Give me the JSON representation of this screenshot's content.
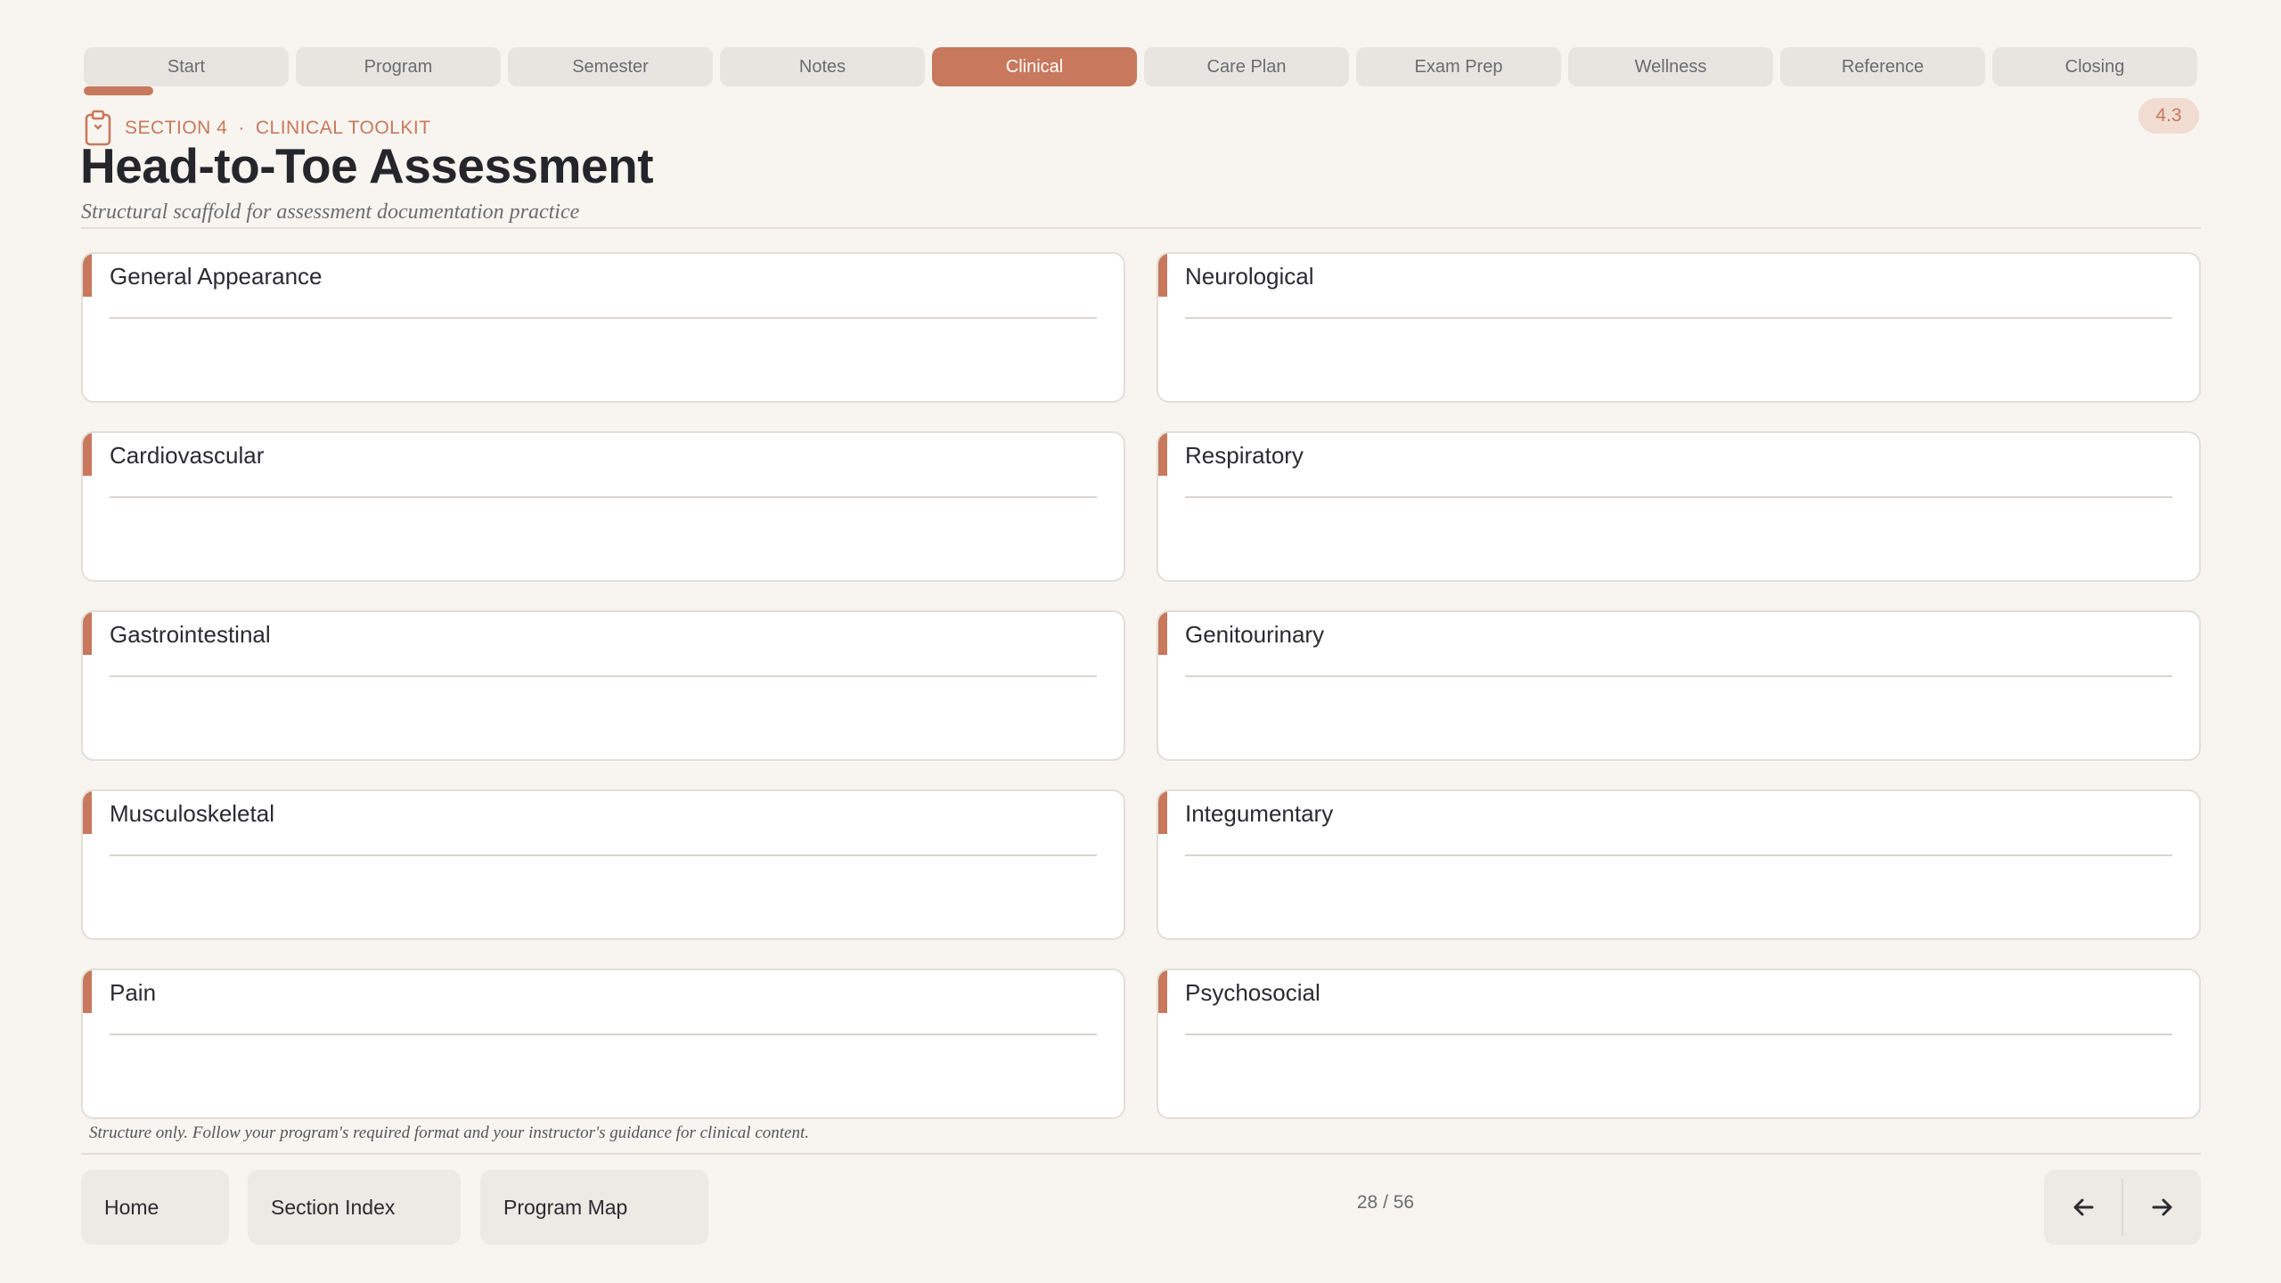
{
  "tabs": [
    {
      "label": "Start"
    },
    {
      "label": "Program"
    },
    {
      "label": "Semester"
    },
    {
      "label": "Notes"
    },
    {
      "label": "Clinical"
    },
    {
      "label": "Care Plan"
    },
    {
      "label": "Exam Prep"
    },
    {
      "label": "Wellness"
    },
    {
      "label": "Reference"
    },
    {
      "label": "Closing"
    }
  ],
  "active_tab_index": 4,
  "progress_fraction": 0.033,
  "header": {
    "section_label": "SECTION 4",
    "separator": "·",
    "category": "CLINICAL TOOLKIT",
    "title": "Head-to-Toe Assessment",
    "subtitle": "Structural scaffold for assessment documentation practice",
    "badge": "4.3",
    "icon": "clipboard-icon"
  },
  "cards": [
    {
      "title": "General Appearance"
    },
    {
      "title": "Neurological"
    },
    {
      "title": "Cardiovascular"
    },
    {
      "title": "Respiratory"
    },
    {
      "title": "Gastrointestinal"
    },
    {
      "title": "Genitourinary"
    },
    {
      "title": "Musculoskeletal"
    },
    {
      "title": "Integumentary"
    },
    {
      "title": "Pain"
    },
    {
      "title": "Psychosocial"
    }
  ],
  "footer": {
    "note": "Structure only. Follow your program's required format and your instructor's guidance for clinical content.",
    "buttons": {
      "home": "Home",
      "section_index": "Section Index",
      "program_map": "Program Map"
    },
    "pager": "28 / 56",
    "prev_icon": "arrow-left-icon",
    "next_icon": "arrow-right-icon"
  },
  "colors": {
    "accent": "#c8785c",
    "background": "#f8f5f0",
    "tab_inactive": "#e8e5e1",
    "card_border": "#e3ded7"
  }
}
